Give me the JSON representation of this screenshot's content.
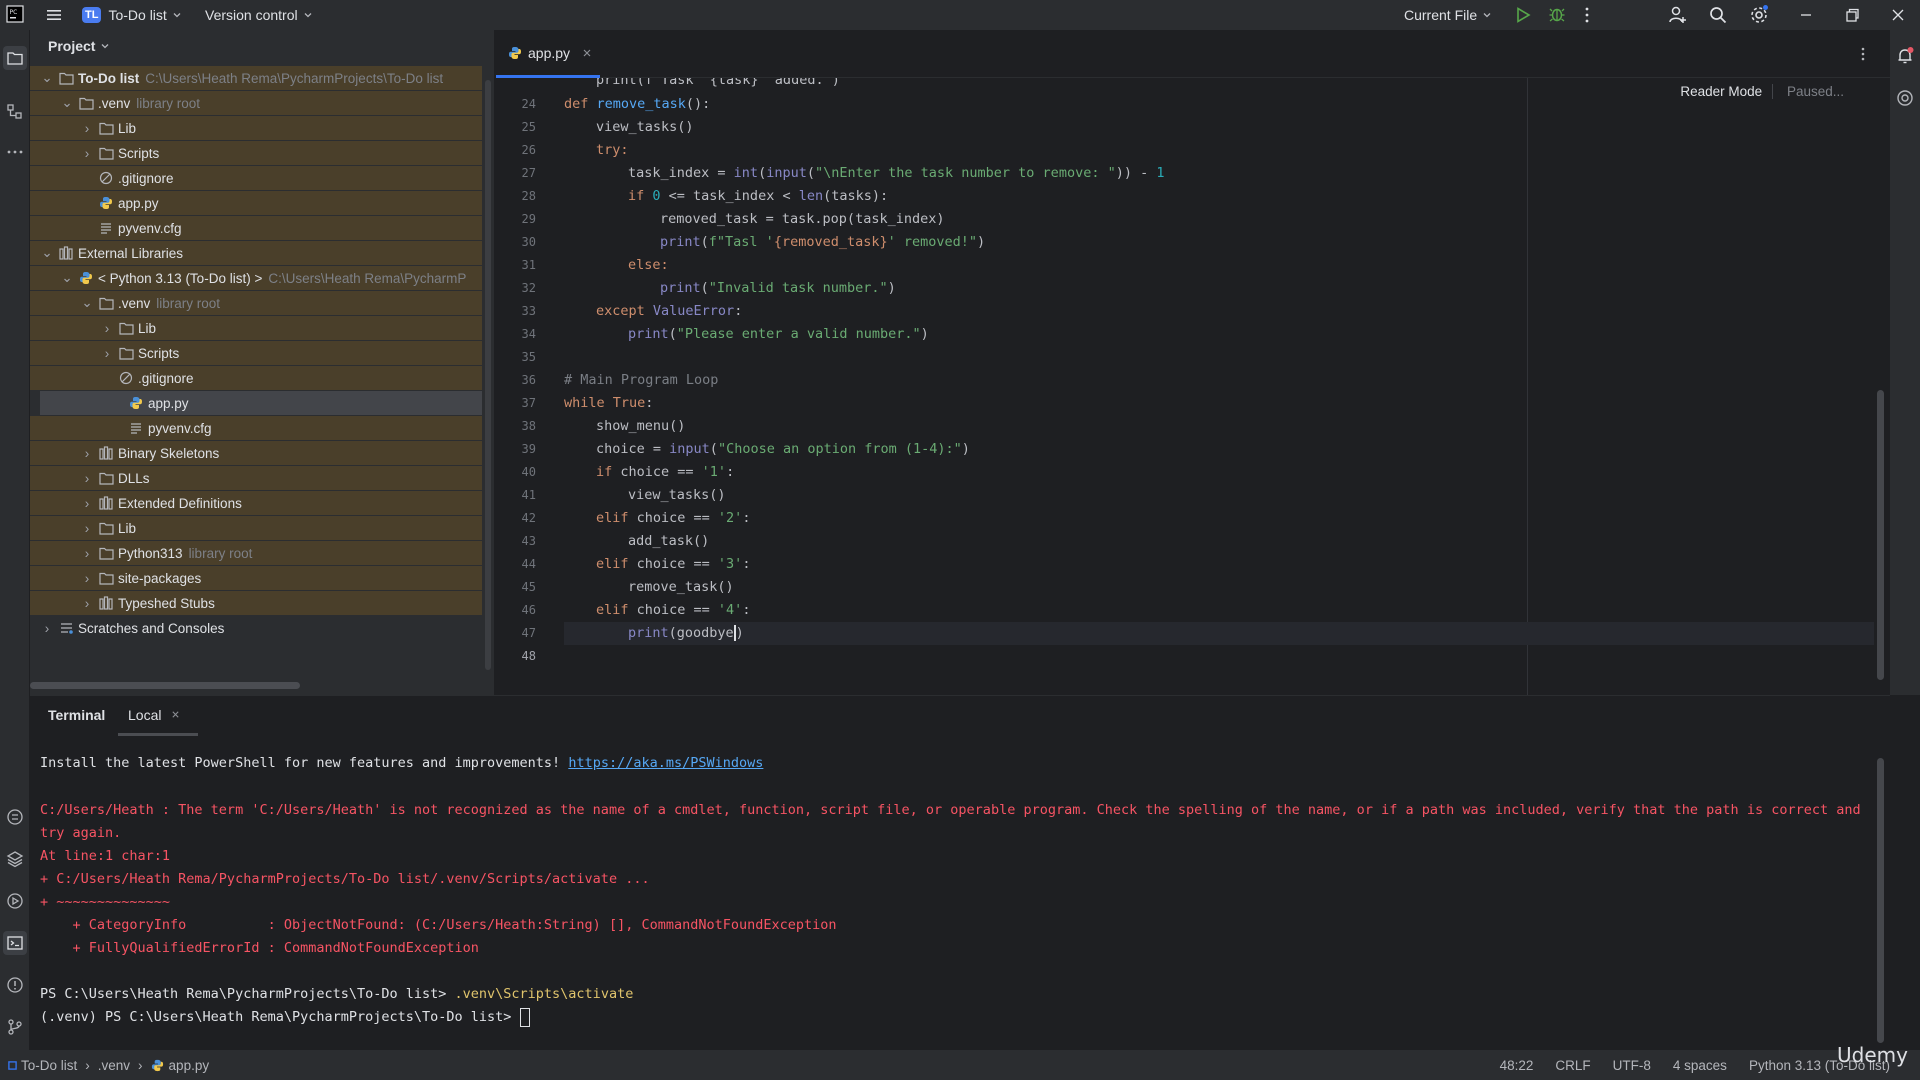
{
  "titlebar": {
    "project_badge": "TL",
    "project_name": "To-Do list",
    "vcs_label": "Version control",
    "run_config": "Current File"
  },
  "project_panel": {
    "title": "Project",
    "tree": [
      {
        "label": "To-Do list",
        "sub": "C:\\Users\\Heath Rema\\PycharmProjects\\To-Do list"
      },
      {
        "label": ".venv",
        "sub": "library root"
      },
      {
        "label": "Lib",
        "sub": ""
      },
      {
        "label": "Scripts",
        "sub": ""
      },
      {
        "label": ".gitignore",
        "sub": ""
      },
      {
        "label": "app.py",
        "sub": ""
      },
      {
        "label": "pyvenv.cfg",
        "sub": ""
      },
      {
        "label": "External Libraries",
        "sub": ""
      },
      {
        "label": "< Python 3.13 (To-Do list) >",
        "sub": "C:\\Users\\Heath Rema\\PycharmP"
      },
      {
        "label": ".venv",
        "sub": "library root"
      },
      {
        "label": "Lib",
        "sub": ""
      },
      {
        "label": "Scripts",
        "sub": ""
      },
      {
        "label": ".gitignore",
        "sub": ""
      },
      {
        "label": "app.py",
        "sub": ""
      },
      {
        "label": "pyvenv.cfg",
        "sub": ""
      },
      {
        "label": "Binary Skeletons",
        "sub": ""
      },
      {
        "label": "DLLs",
        "sub": ""
      },
      {
        "label": "Extended Definitions",
        "sub": ""
      },
      {
        "label": "Lib",
        "sub": ""
      },
      {
        "label": "Python313",
        "sub": "library root"
      },
      {
        "label": "site-packages",
        "sub": ""
      },
      {
        "label": "Typeshed Stubs",
        "sub": ""
      },
      {
        "label": "Scratches and Consoles",
        "sub": ""
      }
    ]
  },
  "editor": {
    "tab_label": "app.py",
    "reader_mode": "Reader Mode",
    "paused": "Paused...",
    "line_numbers": [
      "24",
      "25",
      "26",
      "27",
      "28",
      "29",
      "30",
      "31",
      "32",
      "33",
      "34",
      "35",
      "36",
      "37",
      "38",
      "39",
      "40",
      "41",
      "42",
      "43",
      "44",
      "45",
      "46",
      "47",
      "48"
    ],
    "top_partial": "print(f\"Task '{task}' added.\")",
    "code": {
      "l25_kw": "def ",
      "l25_fn": "remove_task",
      "l25_rest": "():",
      "l26": "view_tasks()",
      "l27": "try:",
      "l28_a": "task_index = ",
      "l28_b": "int",
      "l28_c": "(",
      "l28_d": "input",
      "l28_e": "(",
      "l28_f": "\"\\nEnter the task number to remove: \"",
      "l28_g": ")) - ",
      "l28_h": "1",
      "l29_a": "if ",
      "l29_b": "0",
      "l29_c": " <= task_index < ",
      "l29_d": "len",
      "l29_e": "(tasks):",
      "l30": "removed_task = task.pop(task_index)",
      "l31_a": "print",
      "l31_b": "(",
      "l31_c": "f\"Tasl '",
      "l31_d": "{removed_task}",
      "l31_e": "' removed!\"",
      "l31_f": ")",
      "l32": "else:",
      "l33_a": "print",
      "l33_b": "(",
      "l33_c": "\"Invalid task number.\"",
      "l33_d": ")",
      "l34_a": "except ",
      "l34_b": "ValueError",
      "l34_c": ":",
      "l35_a": "print",
      "l35_b": "(",
      "l35_c": "\"Please enter a valid number.\"",
      "l35_d": ")",
      "l37": "# Main Program Loop",
      "l38_a": "while ",
      "l38_b": "True",
      "l38_c": ":",
      "l39": "show_menu()",
      "l40_a": "choice = ",
      "l40_b": "input",
      "l40_c": "(",
      "l40_d": "\"Choose an option from (1-4):\"",
      "l40_e": ")",
      "l41_a": "if ",
      "l41_b": "choice == ",
      "l41_c": "'1'",
      "l41_d": ":",
      "l42": "view_tasks()",
      "l43_a": "elif ",
      "l43_b": "choice == ",
      "l43_c": "'2'",
      "l43_d": ":",
      "l44": "add_task()",
      "l45_a": "elif ",
      "l45_b": "choice == ",
      "l45_c": "'3'",
      "l45_d": ":",
      "l46": "remove_task()",
      "l47_a": "elif ",
      "l47_b": "choice == ",
      "l47_c": "'4'",
      "l47_d": ":",
      "l48_a": "print",
      "l48_b": "(goodbye",
      "l48_c": ")"
    }
  },
  "terminal": {
    "tab_terminal": "Terminal",
    "tab_local": "Local",
    "install_text": "Install the latest PowerShell for new features and improvements! ",
    "install_link": "https://aka.ms/PSWindows",
    "err1": "C:/Users/Heath : The term 'C:/Users/Heath' is not recognized as the name of a cmdlet, function, script file, or operable program. Check the spelling of the name, or if a path was included, verify that the path is correct and",
    "err2": "try again.",
    "err3": "At line:1 char:1",
    "err4": "+ C:/Users/Heath Rema/PycharmProjects/To-Do list/.venv/Scripts/activate ...",
    "err5": "+ ~~~~~~~~~~~~~~",
    "err6": "    + CategoryInfo          : ObjectNotFound: (C:/Users/Heath:String) [], CommandNotFoundException",
    "err7": "    + FullyQualifiedErrorId : CommandNotFoundException",
    "ps1_prompt": "PS C:\\Users\\Heath Rema\\PycharmProjects\\To-Do list> ",
    "ps1_cmd": ".venv\\Scripts\\activate",
    "ps2_prompt": "(.venv) PS C:\\Users\\Heath Rema\\PycharmProjects\\To-Do list> "
  },
  "statusbar": {
    "crumb_project": "To-Do list",
    "crumb_venv": ".venv",
    "crumb_file": "app.py",
    "position": "48:22",
    "line_sep": "CRLF",
    "encoding": "UTF-8",
    "indent": "4 spaces",
    "interpreter": "Python 3.13 (To-Do list)"
  },
  "watermark": "Udemy"
}
